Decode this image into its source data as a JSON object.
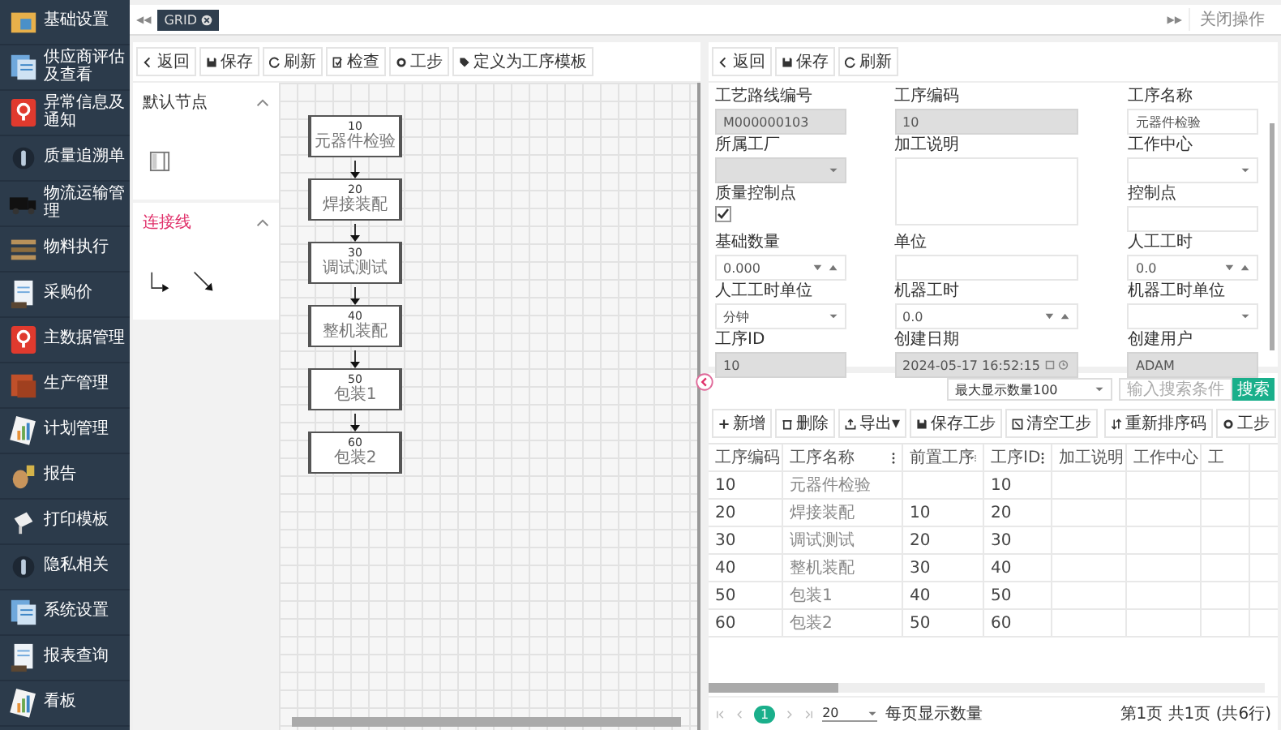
{
  "sidebar": {
    "items": [
      {
        "label": "基础设置"
      },
      {
        "label": "供应商评估及查看"
      },
      {
        "label": "异常信息及通知"
      },
      {
        "label": "质量追溯单"
      },
      {
        "label": "物流运输管理"
      },
      {
        "label": "物料执行"
      },
      {
        "label": "采购价"
      },
      {
        "label": "主数据管理"
      },
      {
        "label": "生产管理"
      },
      {
        "label": "计划管理"
      },
      {
        "label": "报告"
      },
      {
        "label": "打印模板"
      },
      {
        "label": "隐私相关"
      },
      {
        "label": "系统设置"
      },
      {
        "label": "报表查询"
      },
      {
        "label": "看板"
      }
    ]
  },
  "top_bar": {
    "collapse": "◀◀",
    "tabs": [
      {
        "label": "GRID",
        "selected": true
      }
    ],
    "expand": "▶▶",
    "close_menu": "关闭操作"
  },
  "designer": {
    "toolbar": [
      "返回",
      "保存",
      "刷新",
      "检查",
      "工步",
      "定义为工序模板"
    ],
    "palette": [
      {
        "title": "默认节点",
        "kind": "nodes",
        "expanded": true
      },
      {
        "title": "连接线",
        "kind": "lines",
        "expanded": true
      }
    ],
    "nodes": [
      {
        "code": "10",
        "name": "元器件检验"
      },
      {
        "code": "20",
        "name": "焊接装配"
      },
      {
        "code": "30",
        "name": "调试测试"
      },
      {
        "code": "40",
        "name": "整机装配"
      },
      {
        "code": "50",
        "name": "包装1"
      },
      {
        "code": "60",
        "name": "包装2"
      }
    ]
  },
  "form": {
    "toolbar": [
      "返回",
      "保存",
      "刷新"
    ],
    "fields": [
      {
        "label": "工艺路线编号",
        "kind": "text",
        "value": "M000000103",
        "disabled": true
      },
      {
        "label": "工序编码",
        "kind": "text",
        "value": "10",
        "disabled": true
      },
      {
        "label": "工序名称",
        "kind": "text",
        "value": "元器件检验",
        "disabled": false
      },
      {
        "label": "所属工厂",
        "kind": "select",
        "disabled": true
      },
      {
        "label": "加工说明",
        "kind": "textarea",
        "disabled": false
      },
      {
        "label": "工作中心",
        "kind": "select",
        "disabled": false
      },
      {
        "label": "质量控制点",
        "kind": "checkbox",
        "checked": true
      },
      {
        "label": "控制点",
        "kind": "text",
        "disabled": false
      },
      {
        "label": "基础数量",
        "kind": "number",
        "value": "0.000",
        "disabled": false
      },
      {
        "label": "单位",
        "kind": "text",
        "disabled": false
      },
      {
        "label": "人工工时",
        "kind": "number",
        "value": "0.0",
        "disabled": false
      },
      {
        "label": "人工工时单位",
        "kind": "select",
        "value": "分钟",
        "disabled": false
      },
      {
        "label": "机器工时",
        "kind": "number",
        "value": "0.0",
        "disabled": false
      },
      {
        "label": "机器工时单位",
        "kind": "select",
        "disabled": false
      },
      {
        "label": "工序ID",
        "kind": "text",
        "value": "10",
        "disabled": true
      },
      {
        "label": "创建日期",
        "kind": "datetime",
        "value": "2024-05-17 16:52:15",
        "disabled": true
      },
      {
        "label": "创建用户",
        "kind": "text",
        "value": "ADAM",
        "disabled": true
      }
    ]
  },
  "table": {
    "max_rows_select": "最大显示数量100",
    "search": {
      "placeholder": "输入搜索条件"
    },
    "search_button": "搜索",
    "toolbar": [
      "新增",
      "删除",
      "导出▾",
      "保存工步",
      "清空工步"
    ],
    "toolbar_right": [
      "重新排序码",
      "工步"
    ],
    "columns": [
      "工序编码",
      "工序名称",
      "前置工序",
      "工序ID",
      "加工说明",
      "工作中心",
      "工"
    ],
    "rows": [
      {
        "code": "10",
        "name": "元器件检验",
        "op_id": "10"
      },
      {
        "code": "20",
        "name": "焊接装配",
        "prev": "10",
        "op_id": "20"
      },
      {
        "code": "30",
        "name": "调试测试",
        "prev": "20",
        "op_id": "30"
      },
      {
        "code": "40",
        "name": "整机装配",
        "prev": "30",
        "op_id": "40"
      },
      {
        "code": "50",
        "name": "包装1",
        "prev": "40",
        "op_id": "50"
      },
      {
        "code": "60",
        "name": "包装2",
        "prev": "50",
        "op_id": "60"
      }
    ],
    "pagination": {
      "pages": [
        {
          "label": "1",
          "selected": true
        }
      ],
      "page_size": "20",
      "page_size_label": "每页显示数量",
      "summary": "第1页 共1页 (共6行)"
    }
  }
}
